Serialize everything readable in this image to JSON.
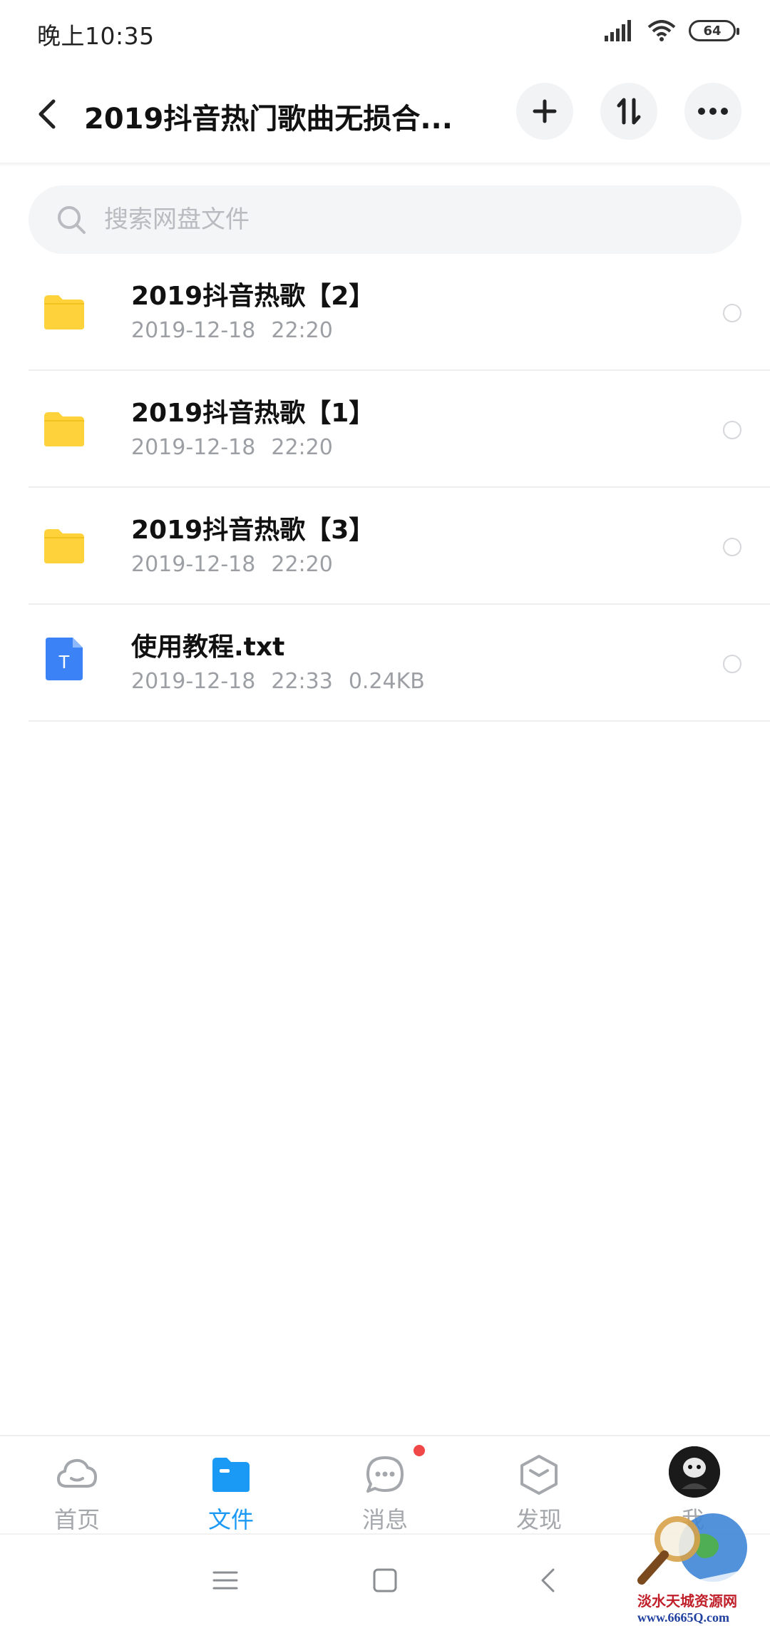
{
  "status_bar": {
    "time": "晚上10:35",
    "battery": "64"
  },
  "header": {
    "title": "2019抖音热门歌曲无损合..."
  },
  "search": {
    "placeholder": "搜索网盘文件"
  },
  "files": [
    {
      "type": "folder",
      "name": "2019抖音热歌【2】",
      "date": "2019-12-18",
      "time": "22:20",
      "size": ""
    },
    {
      "type": "folder",
      "name": "2019抖音热歌【1】",
      "date": "2019-12-18",
      "time": "22:20",
      "size": ""
    },
    {
      "type": "folder",
      "name": "2019抖音热歌【3】",
      "date": "2019-12-18",
      "time": "22:20",
      "size": ""
    },
    {
      "type": "txt",
      "name": "使用教程.txt",
      "date": "2019-12-18",
      "time": "22:33",
      "size": "0.24KB",
      "icon_letter": "T"
    }
  ],
  "bottom_nav": {
    "tabs": [
      {
        "label": "首页",
        "icon": "cloud-icon"
      },
      {
        "label": "文件",
        "icon": "folder-icon",
        "active": true
      },
      {
        "label": "消息",
        "icon": "chat-icon",
        "has_badge": true
      },
      {
        "label": "发现",
        "icon": "cube-icon"
      },
      {
        "label": "我",
        "icon": "avatar"
      }
    ]
  },
  "watermark": {
    "line1": "淡水天城资源网",
    "line2": "www.6665Q.com"
  },
  "colors": {
    "accent": "#1a99f5",
    "folder": "#fdd23a",
    "txt_icon": "#3b82f6",
    "badge": "#f04848"
  }
}
